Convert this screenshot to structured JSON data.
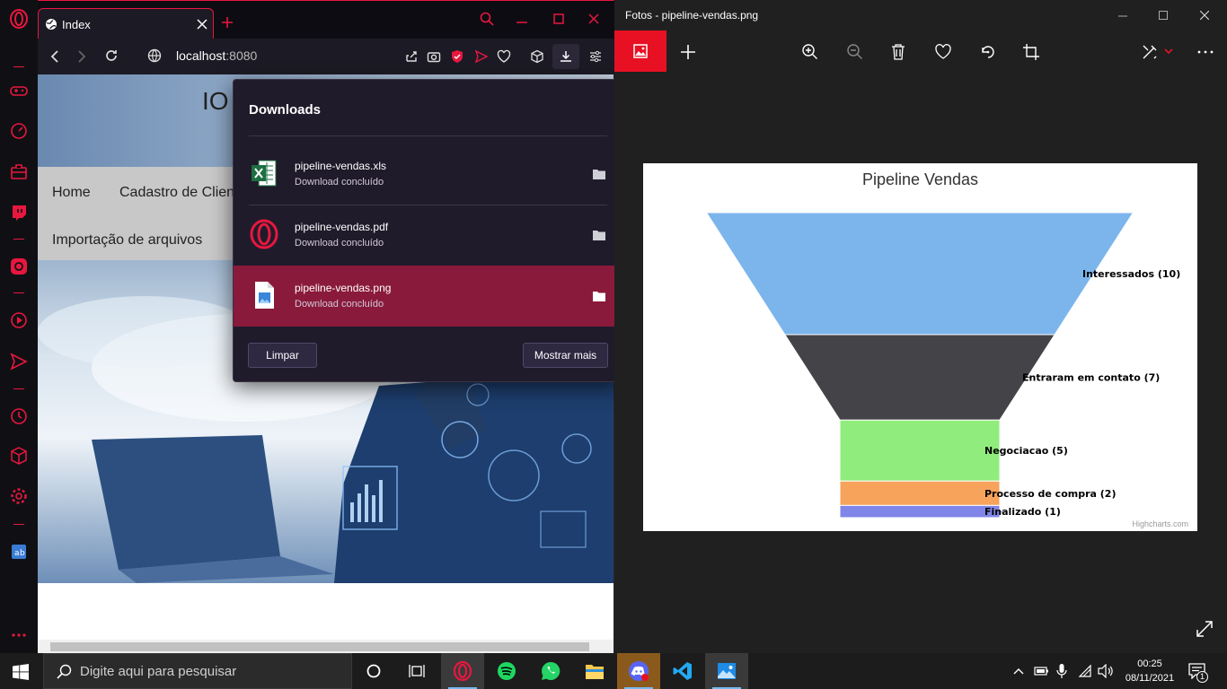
{
  "browser": {
    "tab_title": "Index",
    "url_host": "localhost",
    "url_port": ":8080"
  },
  "site": {
    "title_fragment": "IO",
    "nav": {
      "home": "Home",
      "clients": "Cadastro de Clientes",
      "import": "Importação de arquivos"
    }
  },
  "downloads": {
    "title": "Downloads",
    "items": [
      {
        "name": "pipeline-vendas.xls",
        "status": "Download concluído"
      },
      {
        "name": "pipeline-vendas.pdf",
        "status": "Download concluído"
      },
      {
        "name": "pipeline-vendas.png",
        "status": "Download concluído"
      }
    ],
    "clear_label": "Limpar",
    "show_more_label": "Mostrar mais"
  },
  "photos": {
    "title": "Fotos - pipeline-vendas.png"
  },
  "chart_data": {
    "type": "funnel",
    "title": "Pipeline Vendas",
    "categories": [
      "Interessados",
      "Entraram em contato",
      "Negociacao",
      "Processo de compra",
      "Finalizado"
    ],
    "values": [
      10,
      7,
      5,
      2,
      1
    ],
    "labels": [
      "Interessados (10)",
      "Entraram em contato (7)",
      "Negociacao (5)",
      "Processo de compra (2)",
      "Finalizado (1)"
    ],
    "colors": [
      "#7cb5ec",
      "#434348",
      "#90ed7d",
      "#f7a35c",
      "#8085e9"
    ],
    "credits": "Highcharts.com"
  },
  "taskbar": {
    "search_placeholder": "Digite aqui para pesquisar",
    "time": "00:25",
    "date": "08/11/2021",
    "notification_count": "1"
  },
  "colors": {
    "opera_red": "#e8173f",
    "download_active": "#8a1a3b",
    "photos_accent": "#e81123"
  }
}
